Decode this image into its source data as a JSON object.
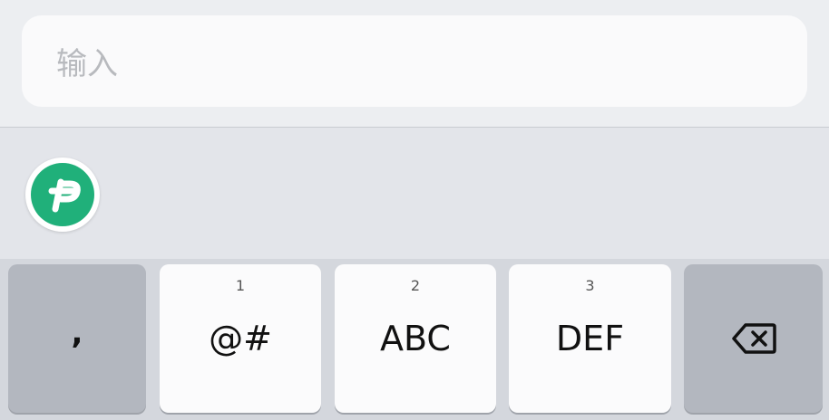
{
  "input": {
    "placeholder": "输入"
  },
  "suggestion": {
    "logo_icon": "app-p-logo-icon",
    "logo_color": "#20b07a"
  },
  "keyboard": {
    "keys": [
      {
        "name": "comma",
        "label": ","
      },
      {
        "name": "symbols",
        "number": "1",
        "label": "@#"
      },
      {
        "name": "abc",
        "number": "2",
        "label": "ABC"
      },
      {
        "name": "def",
        "number": "3",
        "label": "DEF"
      },
      {
        "name": "delete",
        "icon": "backspace-icon"
      }
    ]
  }
}
